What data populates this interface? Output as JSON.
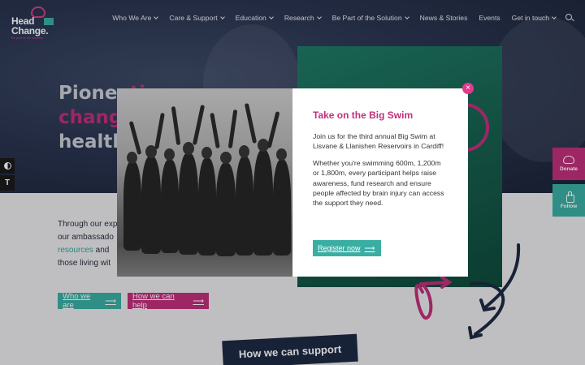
{
  "logo": {
    "line1": "Head",
    "line2": "Change.",
    "tagline": "Be part of the solution"
  },
  "nav": {
    "items": [
      {
        "label": "Who We Are",
        "dropdown": true
      },
      {
        "label": "Care & Support",
        "dropdown": true
      },
      {
        "label": "Education",
        "dropdown": true
      },
      {
        "label": "Research",
        "dropdown": true
      },
      {
        "label": "Be Part of the Solution",
        "dropdown": true
      },
      {
        "label": "News & Stories",
        "dropdown": false
      },
      {
        "label": "Events",
        "dropdown": false
      },
      {
        "label": "Get in touch",
        "dropdown": true
      }
    ],
    "search_icon": "search-icon"
  },
  "hero": {
    "line1": "Pionee",
    "line1_accent": "ti",
    "line2": "change",
    "line3": "health"
  },
  "body": {
    "p_start": "Through our exp",
    "p_line2": "our ambassado",
    "p_link": "resources",
    "p_line3_rest": " and",
    "p_line4": "those living wit"
  },
  "buttons": {
    "who_we_are": "Who we are",
    "how_we_can_help": "How we can help",
    "arrow": "⟶"
  },
  "banner": {
    "how_we_can_support": "How we can support"
  },
  "side": {
    "donate": "Donate",
    "follow": "Follow"
  },
  "a11y": {
    "contrast_icon": "contrast-icon",
    "font_icon": "T"
  },
  "modal": {
    "title": "Take on the Big Swim",
    "p1": "Join us for the third annual Big Swim at Lisvane & Llanishen Reservoirs in Cardiff!",
    "p2": "Whether you're swimming 600m, 1,200m or 1,800m, every participant helps raise awareness, fund research and ensure people affected by brain injury can access the support they need.",
    "cta": "Register now",
    "close": "×"
  },
  "colors": {
    "pink": "#c0307c",
    "teal": "#3aaea3",
    "navy": "#1e2a44"
  }
}
